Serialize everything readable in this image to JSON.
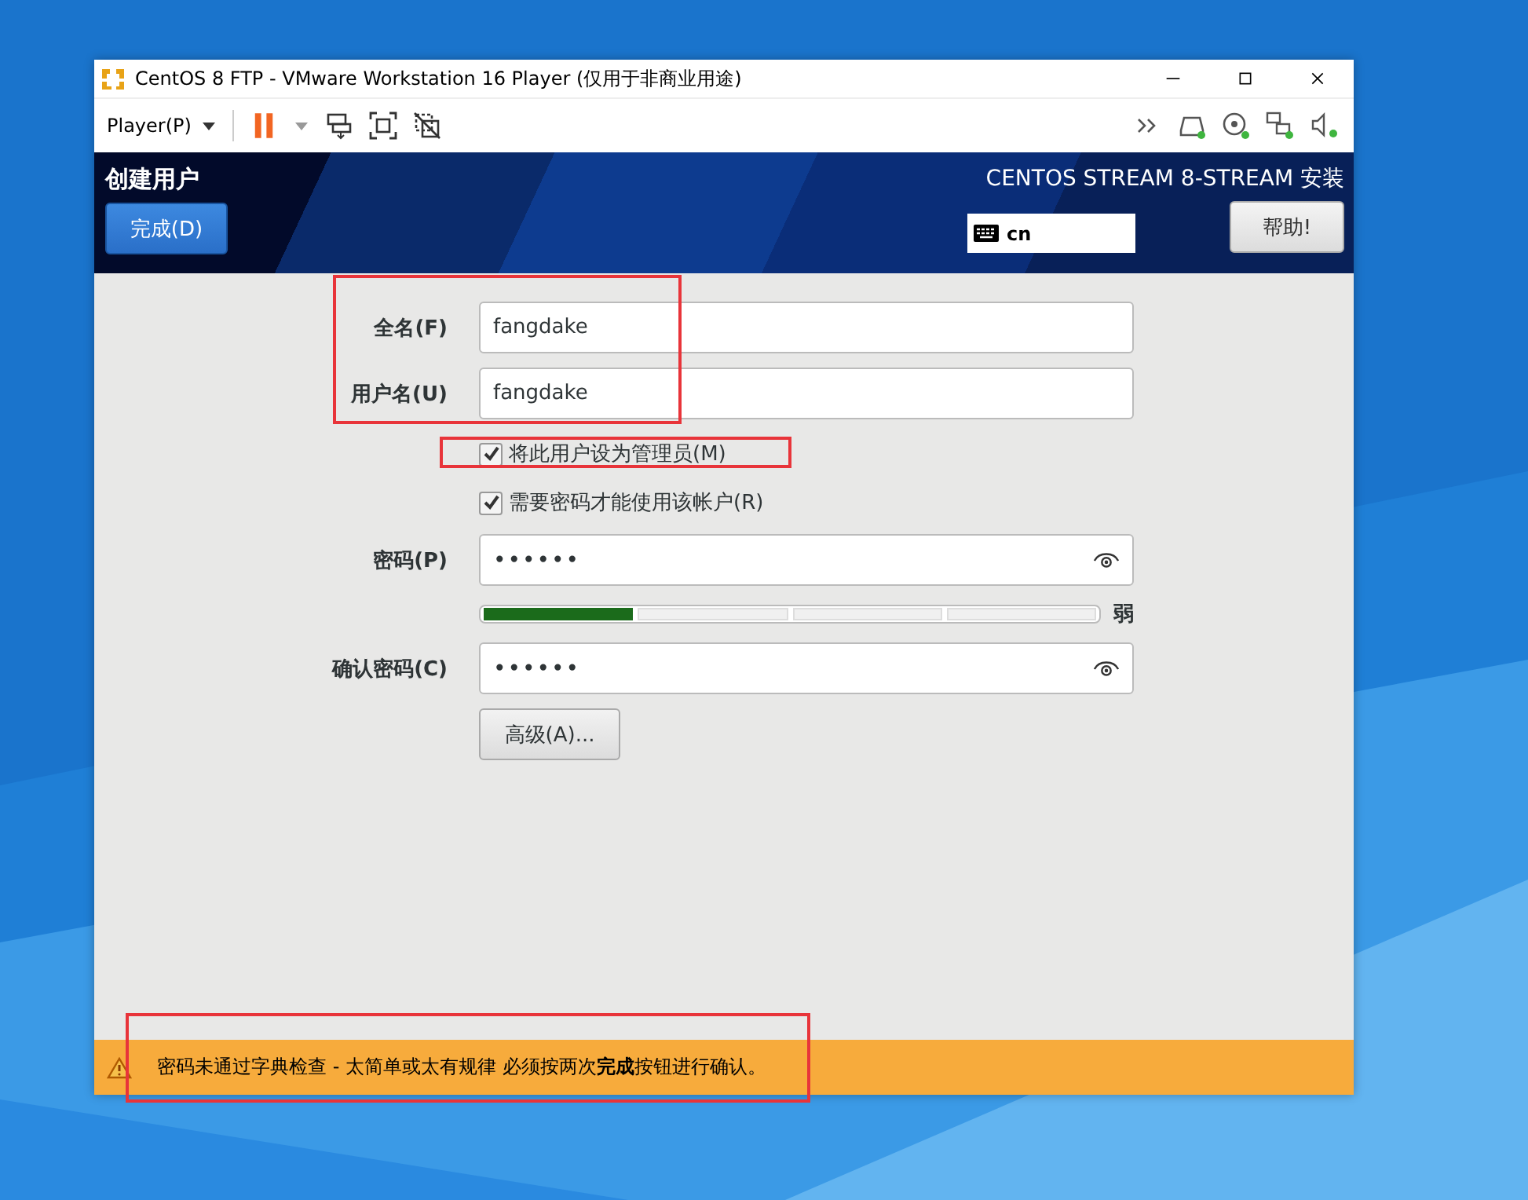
{
  "window": {
    "title": "CentOS 8 FTP - VMware Workstation 16 Player (仅用于非商业用途)"
  },
  "toolbar": {
    "player_menu": "Player(P)"
  },
  "header": {
    "title": "创建用户",
    "done_button": "完成(D)",
    "product": "CENTOS STREAM 8-STREAM 安装",
    "keyboard_layout": "cn",
    "help_button": "帮助!"
  },
  "form": {
    "fields": [
      {
        "kind": "text",
        "label": "全名(F)",
        "value": "fangdake"
      },
      {
        "kind": "text",
        "label": "用户名(U)",
        "value": "fangdake"
      }
    ],
    "checkboxes": [
      {
        "label": "将此用户设为管理员(M)",
        "checked": true
      },
      {
        "label": "需要密码才能使用该帐户(R)",
        "checked": true
      }
    ],
    "password": {
      "label": "密码(P)",
      "value": "••••••"
    },
    "strength": {
      "level": 0.25,
      "label": "弱"
    },
    "confirm": {
      "label": "确认密码(C)",
      "value": "••••••"
    },
    "advanced_button": "高级(A)..."
  },
  "warning": {
    "text": "密码未通过字典检查 - 太简单或太有规律 必须按两次**完成**按钮进行确认。"
  }
}
